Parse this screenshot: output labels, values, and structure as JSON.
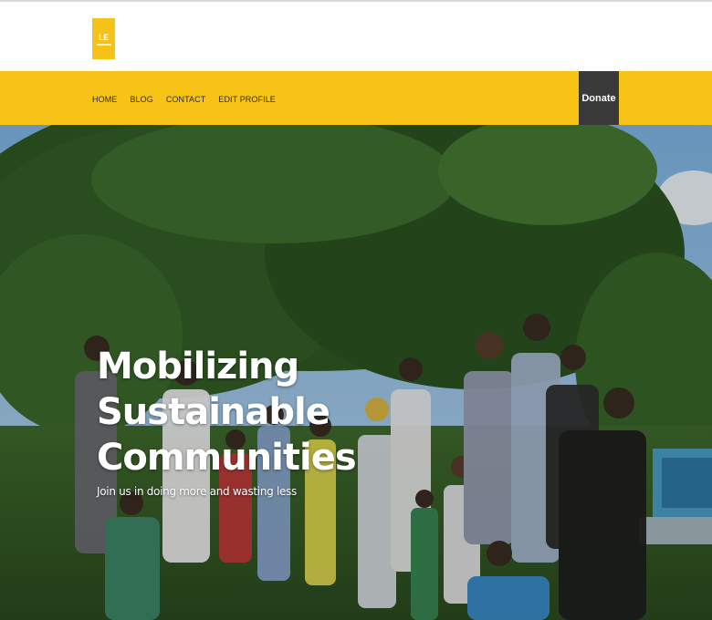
{
  "brand": {
    "logo_text": "LE"
  },
  "nav": {
    "items": [
      {
        "label": "HOME"
      },
      {
        "label": "BLOG"
      },
      {
        "label": "CONTACT"
      },
      {
        "label": "EDIT PROFILE"
      }
    ],
    "donate_label": "Donate"
  },
  "hero": {
    "title": "Mobilizing Sustainable Communities",
    "subtitle": "Join us in doing more and wasting less"
  },
  "colors": {
    "accent_yellow": "#f8c317",
    "donate_bg": "#3a3a3a",
    "hero_text": "#ffffff"
  }
}
